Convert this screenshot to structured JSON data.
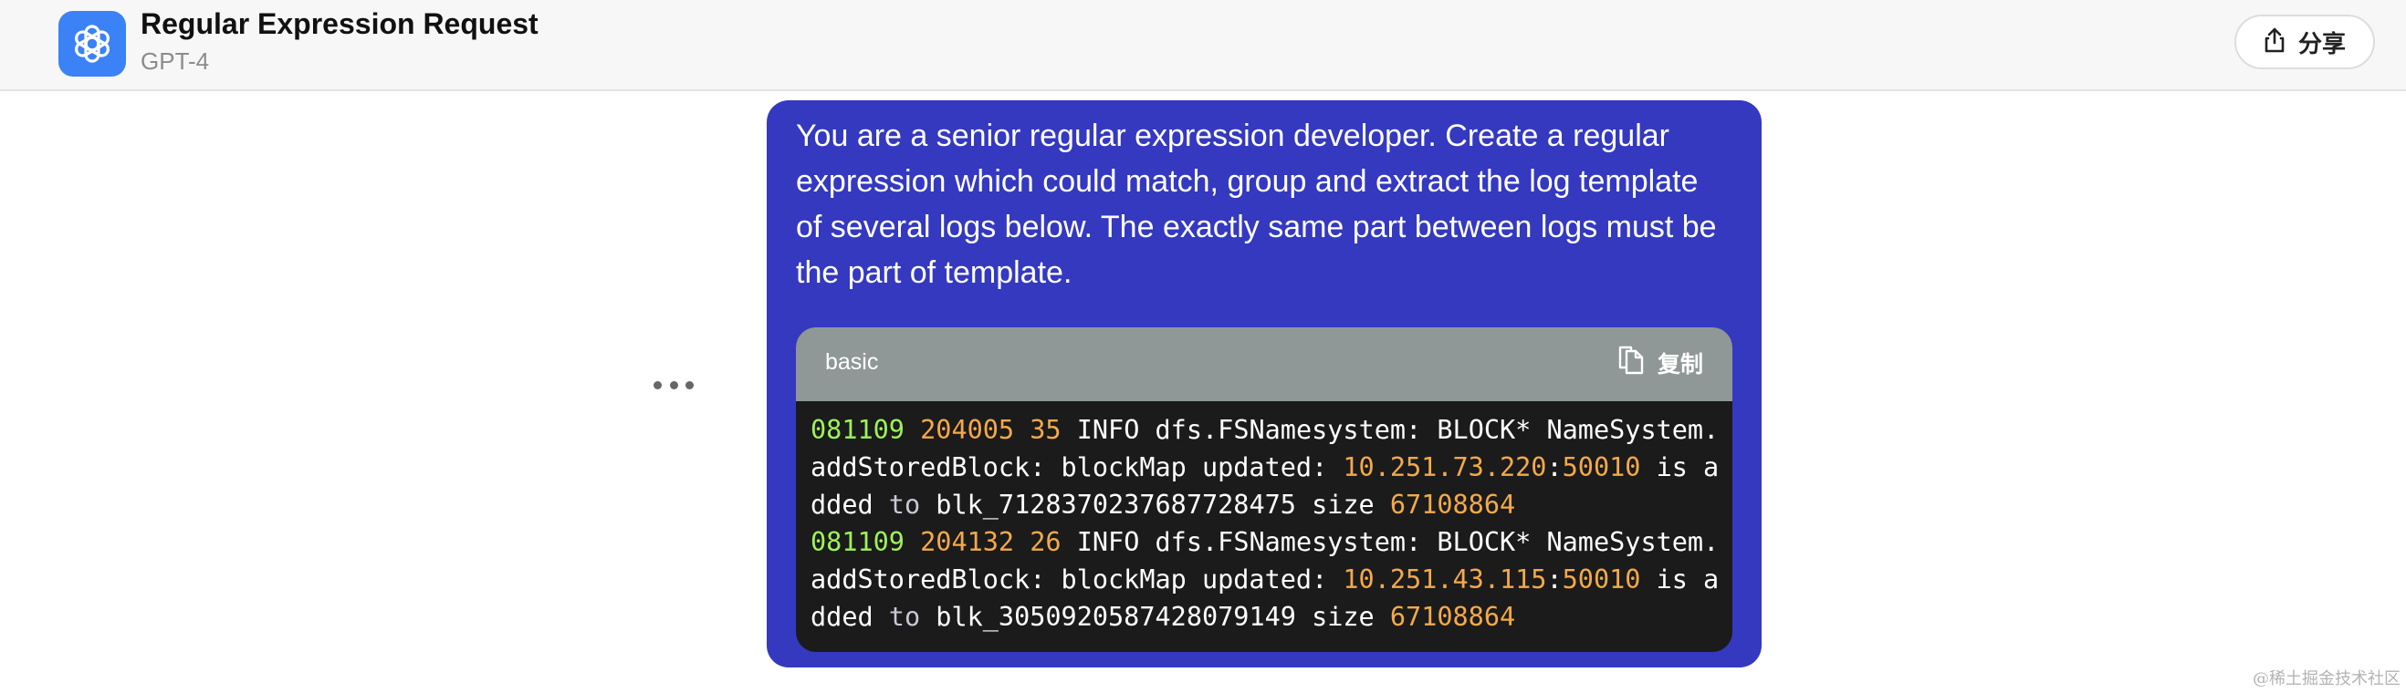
{
  "header": {
    "title": "Regular Expression Request",
    "subtitle": "GPT-4",
    "share_label": "分享"
  },
  "message": {
    "text": "You are a senior regular expression developer. Create a regular expression which could match, group and extract the log template of several logs below. The exactly same part between logs must be the part of template."
  },
  "code_block": {
    "language": "basic",
    "copy_label": "复制",
    "lines": [
      {
        "date": "081109",
        "time": "204005",
        "pid": "35",
        "text1": " INFO dfs.FSNamesystem: BLOCK* NameSystem.addStoredBlock: blockMap updated: ",
        "ip": "10.251.73.220",
        "colon": ":",
        "port": "50010",
        "text2": " is added ",
        "kw": "to",
        "text3": " blk_7128370237687728475 size ",
        "size": "67108864"
      },
      {
        "date": "081109",
        "time": "204132",
        "pid": "26",
        "text1": " INFO dfs.FSNamesystem: BLOCK* NameSystem.addStoredBlock: blockMap updated: ",
        "ip": "10.251.43.115",
        "colon": ":",
        "port": "50010",
        "text2": " is added ",
        "kw": "to",
        "text3": " blk_3050920587428079149 size ",
        "size": "67108864"
      }
    ]
  },
  "watermark": "@稀土掘金技术社区",
  "icons": {
    "app": "openai-logo-icon",
    "share": "share-icon",
    "copy": "copy-icon",
    "more": "more-horizontal-icon"
  },
  "colors": {
    "bubble": "#3439c0",
    "code_bg": "#1b1b1b",
    "code_header": "#8f9897",
    "date_token": "#9ef25a",
    "number_token": "#f4a94a",
    "app_icon": "#3b82f6"
  }
}
